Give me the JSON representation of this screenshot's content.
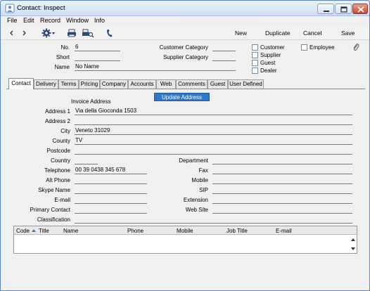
{
  "window": {
    "title": "Contact: Inspect"
  },
  "menu": [
    "File",
    "Edit",
    "Record",
    "Window",
    "Info"
  ],
  "toolbar": {
    "new_label": "New",
    "duplicate_label": "Duplicate",
    "cancel_label": "Cancel",
    "save_label": "Save"
  },
  "header": {
    "no_label": "No.",
    "no_value": "6",
    "short_label": "Short",
    "short_value": "",
    "name_label": "Name",
    "name_value": "No Name",
    "customer_category_label": "Customer Category",
    "customer_category_value": "",
    "supplier_category_label": "Supplier Category",
    "supplier_category_value": "",
    "checkboxes": [
      "Customer",
      "Supplier",
      "Guest",
      "Dealer"
    ],
    "employee_label": "Employee"
  },
  "tabs": [
    "Contact",
    "Delivery",
    "Terms",
    "Pricing",
    "Company",
    "Accounts",
    "Web",
    "Comments",
    "Guest",
    "User Defined"
  ],
  "contact": {
    "invoice_address_label": "Invoice Address",
    "update_address_label": "Update Address",
    "address1_label": "Address 1",
    "address1_value": "Via della Gioconda 1503",
    "address2_label": "Address 2",
    "address2_value": "",
    "city_label": "City",
    "city_value": "Veneto 31029",
    "county_label": "County",
    "county_value": "TV",
    "postcode_label": "Postcode",
    "postcode_value": "",
    "country_label": "Country",
    "country_value": "",
    "telephone_label": "Telephone",
    "telephone_value": "00 39 0438 345 678",
    "alt_phone_label": "Alt Phone",
    "alt_phone_value": "",
    "skype_label": "Skype Name",
    "skype_value": "",
    "email_label": "E-mail",
    "email_value": "",
    "primary_contact_label": "Primary Contact",
    "primary_contact_value": "",
    "classification_label": "Classification",
    "classification_value": "",
    "department_label": "Department",
    "department_value": "",
    "fax_label": "Fax",
    "fax_value": "",
    "mobile_label": "Mobile",
    "mobile_value": "",
    "sip_label": "SIP",
    "sip_value": "",
    "extension_label": "Extension",
    "extension_value": "",
    "website_label": "Web Site",
    "website_value": ""
  },
  "grid": {
    "columns": [
      "Code",
      "Title",
      "Name",
      "Phone",
      "Mobile",
      "Job Title",
      "E-mail"
    ]
  },
  "colors": {
    "accent": "#2f77c9",
    "titlebar": "#cfdff3"
  }
}
